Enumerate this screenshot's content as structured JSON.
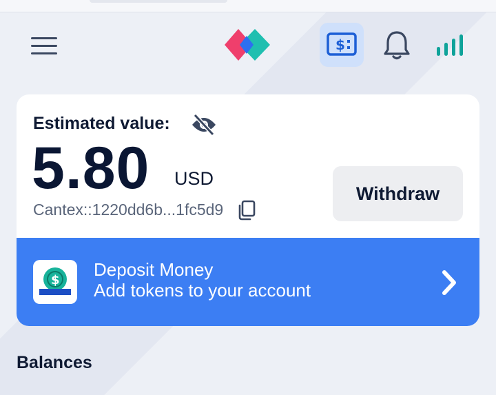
{
  "header": {
    "menu_icon": "hamburger-menu-icon",
    "logo_icon": "diamond-logo-icon",
    "wallet_icon": "dollar-card-icon",
    "bell_icon": "bell-icon",
    "signal_icon": "signal-bars-icon",
    "colors": {
      "accent": "#1d5fd6",
      "wallet_bg": "#cfe0fb",
      "logo_pink": "#ef3f6c",
      "logo_teal": "#1fbfb0",
      "logo_blue": "#2e6ff0",
      "signal": "#0fa39a"
    }
  },
  "estimate": {
    "label": "Estimated value:",
    "hide_icon": "eye-off-icon",
    "value": "5.80",
    "currency": "USD",
    "address": "Cantex::1220dd6b...1fc5d9",
    "copy_icon": "copy-icon"
  },
  "actions": {
    "withdraw_label": "Withdraw"
  },
  "deposit": {
    "title": "Deposit Money",
    "subtitle": "Add tokens to your account",
    "icon": "coin-deposit-icon",
    "chevron_icon": "chevron-right-icon",
    "color": "#3c7ef3"
  },
  "balances": {
    "title": "Balances"
  }
}
